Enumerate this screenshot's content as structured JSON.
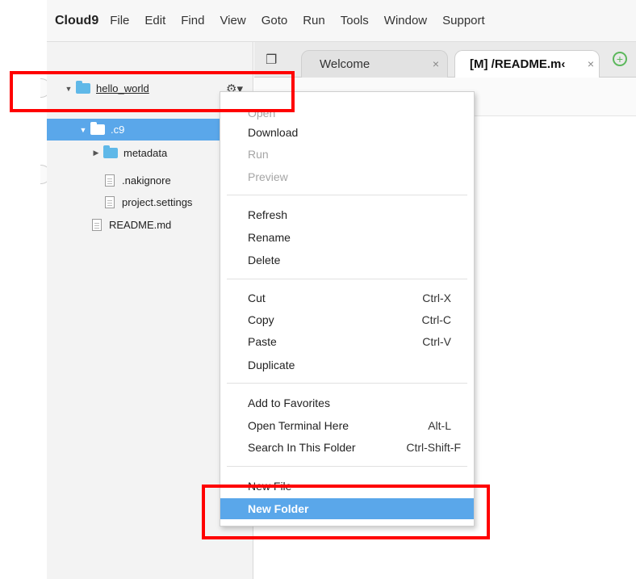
{
  "menubar": {
    "brand": "Cloud9",
    "items": [
      "File",
      "Edit",
      "Find",
      "View",
      "Goto",
      "Run",
      "Tools",
      "Window",
      "Support"
    ]
  },
  "tree": {
    "root": "hello_world",
    "selected": ".c9",
    "child_folder": "metadata",
    "files": [
      ".nakignore",
      "project.settings"
    ],
    "root_file": "README.md"
  },
  "tabs": {
    "welcome": "Welcome",
    "readme": "[M] /README.m‹",
    "close_glyph": "×"
  },
  "context_menu": {
    "open": "Open",
    "download": "Download",
    "run": "Run",
    "preview": "Preview",
    "refresh": "Refresh",
    "rename": "Rename",
    "delete": "Delete",
    "cut": "Cut",
    "cut_sc": "Ctrl-X",
    "copy": "Copy",
    "copy_sc": "Ctrl-C",
    "paste": "Paste",
    "paste_sc": "Ctrl-V",
    "duplicate": "Duplicate",
    "add_favorites": "Add to Favorites",
    "open_terminal": "Open Terminal Here",
    "open_terminal_sc": "Alt-L",
    "search_folder": "Search In This Folder",
    "search_folder_sc": "Ctrl-Shift-F",
    "new_file": "New File",
    "new_folder": "New Folder"
  },
  "colors": {
    "selection": "#5aa7ea",
    "highlight_box": "#ff0000",
    "folder": "#5fb8e8"
  }
}
